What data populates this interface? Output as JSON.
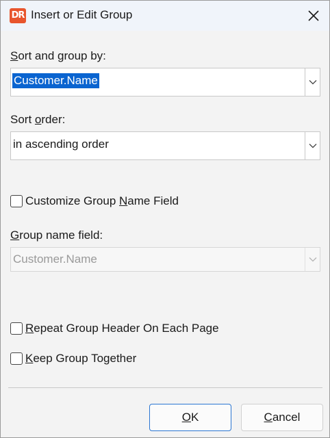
{
  "window": {
    "title": "Insert or Edit Group",
    "app_icon": "DR",
    "close_icon": "close-icon"
  },
  "sort_group": {
    "label_prefix": "S",
    "label_rest": "ort and group by:",
    "value": "Customer.Name"
  },
  "sort_order": {
    "label_prefix": "Sort ",
    "label_underline": "o",
    "label_rest": "rder:",
    "value": "in ascending order"
  },
  "customize": {
    "label_prefix": "Customize Group ",
    "label_underline": "N",
    "label_rest": "ame Field",
    "checked": false
  },
  "group_name_field": {
    "label_underline": "G",
    "label_rest": "roup name field:",
    "value": "Customer.Name",
    "disabled": true
  },
  "repeat_header": {
    "label_underline": "R",
    "label_rest": "epeat Group Header On Each Page",
    "checked": false
  },
  "keep_together": {
    "label_underline": "K",
    "label_rest": "eep Group Together",
    "checked": false
  },
  "buttons": {
    "ok_underline": "O",
    "ok_rest": "K",
    "cancel_underline": "C",
    "cancel_rest": "ancel"
  },
  "colors": {
    "selection": "#0a64d0",
    "app_icon": "#e8552d",
    "primary_border": "#2a76d2"
  }
}
